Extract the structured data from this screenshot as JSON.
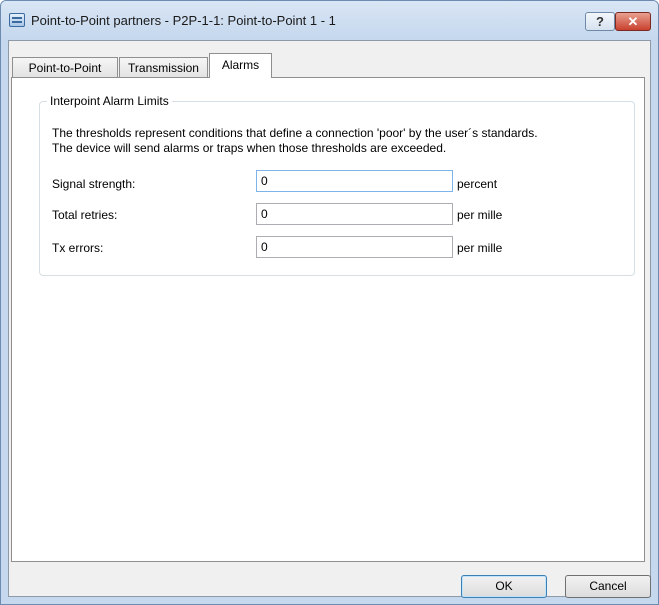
{
  "window": {
    "title": "Point-to-Point partners - P2P-1-1: Point-to-Point 1 - 1",
    "help_label": "?",
    "close_label": "✕"
  },
  "tabs": [
    {
      "label": "Point-to-Point",
      "active": false
    },
    {
      "label": "Transmission",
      "active": false
    },
    {
      "label": "Alarms",
      "active": true
    }
  ],
  "group": {
    "title": "Interpoint Alarm Limits",
    "description_line1": "The thresholds represent conditions that define a connection 'poor' by the user´s standards.",
    "description_line2": "The device will send alarms or traps when those thresholds are exceeded."
  },
  "fields": [
    {
      "label": "Signal strength:",
      "value": "0",
      "unit": "percent"
    },
    {
      "label": "Total retries:",
      "value": "0",
      "unit": "per mille"
    },
    {
      "label": "Tx errors:",
      "value": "0",
      "unit": "per mille"
    }
  ],
  "buttons": {
    "ok": "OK",
    "cancel": "Cancel"
  }
}
